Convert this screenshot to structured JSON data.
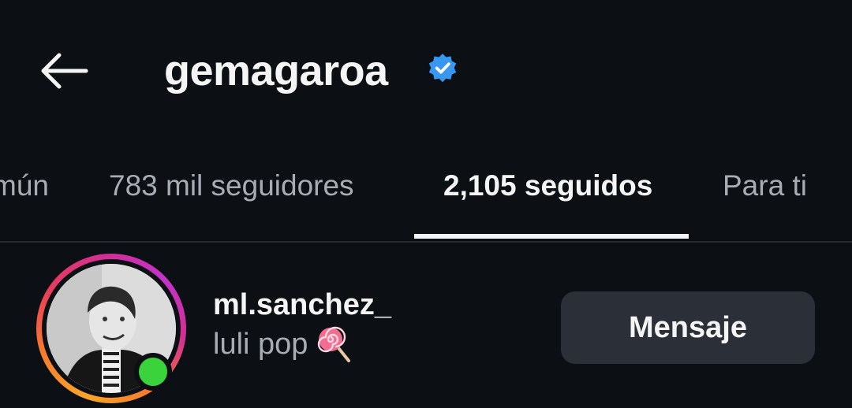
{
  "header": {
    "back_icon": "arrow-left-icon",
    "username": "gemagaroa",
    "verified_icon": "verified-badge-icon"
  },
  "tabs": [
    {
      "label": "mún",
      "active": false
    },
    {
      "label": "783 mil seguidores",
      "active": false
    },
    {
      "label": "2,105 seguidos",
      "active": true
    },
    {
      "label": "Para ti",
      "active": false
    }
  ],
  "list": [
    {
      "username": "ml.sanchez_",
      "subtitle": "luli pop",
      "subtitle_icon": "lollipop-icon",
      "online": true,
      "action_label": "Mensaje"
    }
  ],
  "colors": {
    "background": "#0c0f14",
    "verified_blue": "#3897f0",
    "online_green": "#3bd33b",
    "button_bg": "#2b2f37"
  }
}
